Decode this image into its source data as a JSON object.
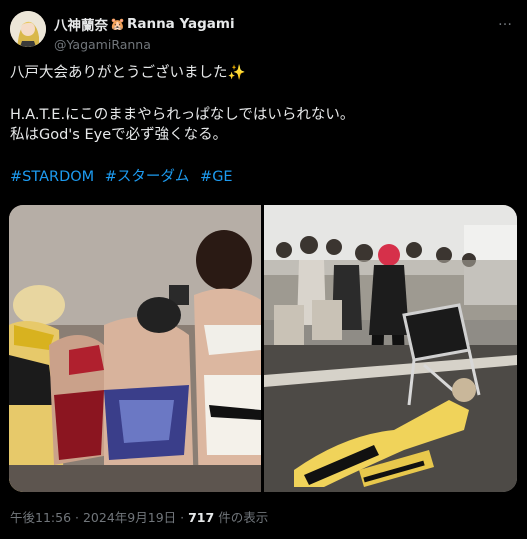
{
  "author": {
    "display_name": "八神蘭奈",
    "emoji": "🐹",
    "display_name_en": "Ranna Yagami",
    "handle": "@YagamiRanna",
    "avatar_icon": "avatar-illustration"
  },
  "more_icon": "…",
  "tweet": {
    "line1": "八戸大会ありがとうございました✨",
    "line2": "H.A.T.E.にこのままやられっぱなしではいられない。",
    "line3": "私はGod's Eyeで必ず強くなる。",
    "hashtags": [
      "#STARDOM",
      "#スターダム",
      "#GE"
    ]
  },
  "meta": {
    "time": "午後11:56",
    "sep1": "·",
    "date": "2024年9月19日",
    "sep2": "·",
    "views": "717",
    "views_label": "件の表示"
  }
}
